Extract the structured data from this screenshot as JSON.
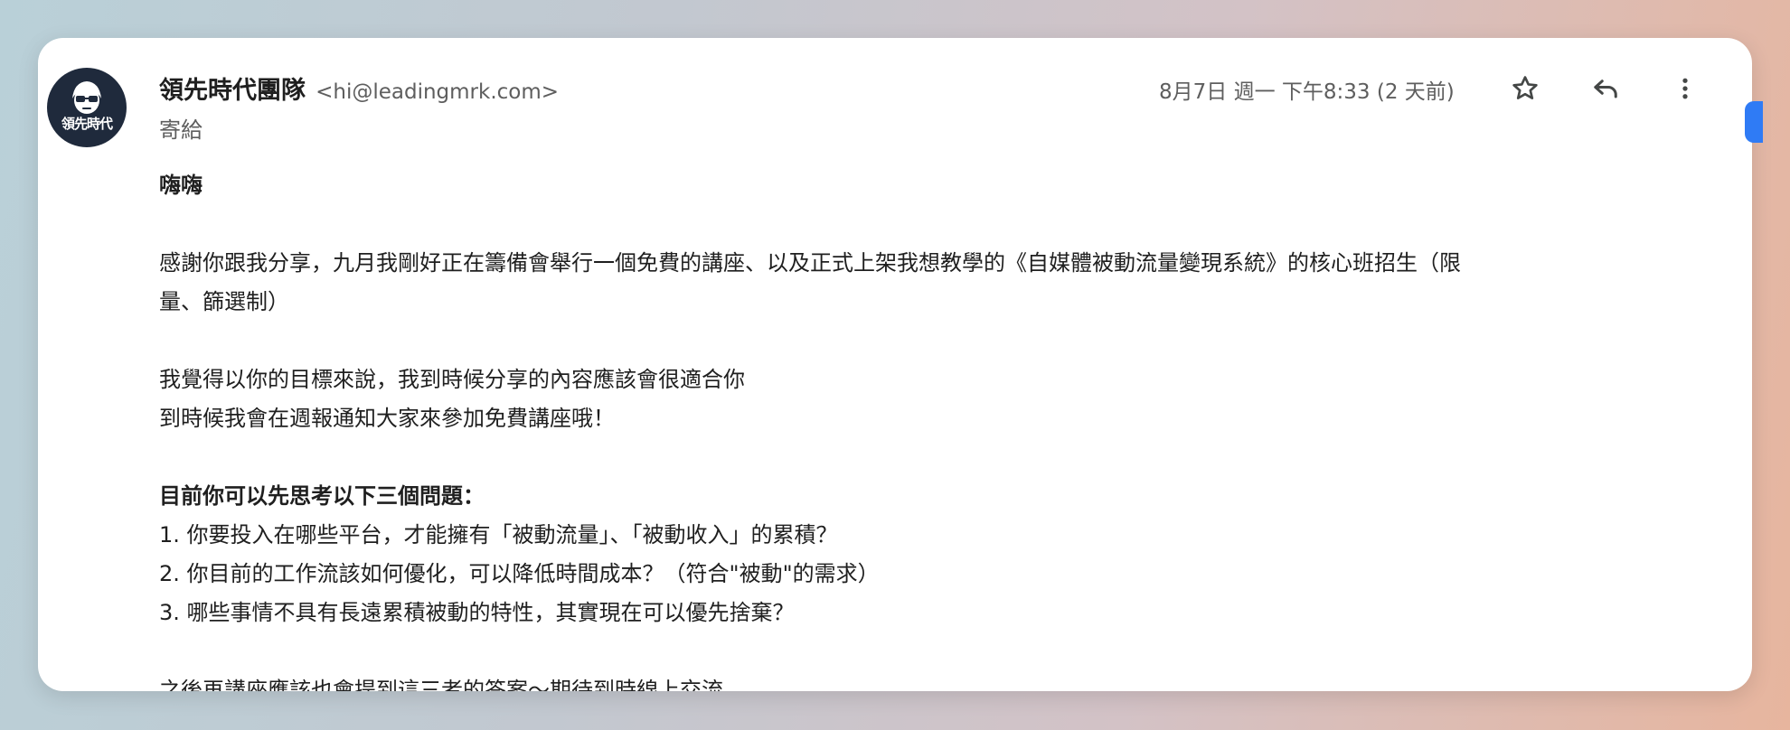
{
  "sender": {
    "name": "領先時代團隊",
    "email": "<hi@leadingmrk.com>",
    "to_label": "寄給",
    "avatar_text": "領先時代"
  },
  "date": "8月7日 週一 下午8:33 (2 天前)",
  "actions": {
    "star_icon": "star-icon",
    "reply_icon": "reply-icon",
    "more_icon": "more-vert-icon"
  },
  "body": {
    "greeting": "嗨嗨",
    "para1_line1": "感謝你跟我分享，九月我剛好正在籌備會舉行一個免費的講座、以及正式上架我想教學的《自媒體被動流量變現系統》的核心班招生（限",
    "para1_line2": "量、篩選制）",
    "para2_line1": "我覺得以你的目標來說，我到時候分享的內容應該會很適合你",
    "para2_line2": "到時候我會在週報通知大家來參加免費講座哦！",
    "questions_heading": "目前你可以先思考以下三個問題：",
    "q1": "1. 你要投入在哪些平台，才能擁有「被動流量」、「被動收入」的累積？",
    "q2": "2. 你目前的工作流該如何優化，可以降低時間成本？（符合\"被動\"的需求）",
    "q3": "3. 哪些事情不具有長遠累積被動的特性，其實現在可以優先捨棄？",
    "closing": "之後再講座應該也會提到這三者的答案～期待到時線上交流"
  },
  "colors": {
    "avatar_bg": "#1f2a3c",
    "text_primary": "#1f1f1f",
    "text_secondary": "#5e5e5e",
    "accent_blue": "#2f7bf5"
  }
}
